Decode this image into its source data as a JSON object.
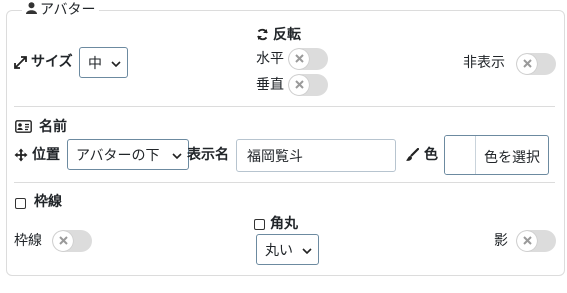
{
  "panel": {
    "title": "アバター"
  },
  "size": {
    "label": "サイズ",
    "value": "中"
  },
  "flip": {
    "heading": "反転",
    "horizontal_label": "水平",
    "vertical_label": "垂直",
    "horizontal_on": false,
    "vertical_on": false
  },
  "hide": {
    "label": "非表示",
    "on": false
  },
  "name_section": {
    "heading": "名前",
    "position_label": "位置",
    "position_value": "アバターの下",
    "display_name_label": "表示名",
    "display_name_value": "福岡覧斗",
    "color_label": "色",
    "color_button_label": "色を選択"
  },
  "border_section": {
    "heading": "枠線",
    "heading_checked": false,
    "border_toggle_label": "枠線",
    "border_on": false,
    "rounded_heading": "角丸",
    "rounded_checked": false,
    "rounded_value": "丸い",
    "shadow_label": "影",
    "shadow_on": false
  },
  "colors": {
    "toggle_off": "#dcdcdc",
    "border": "#dcdcdc",
    "select_border": "#6c8aa0"
  }
}
